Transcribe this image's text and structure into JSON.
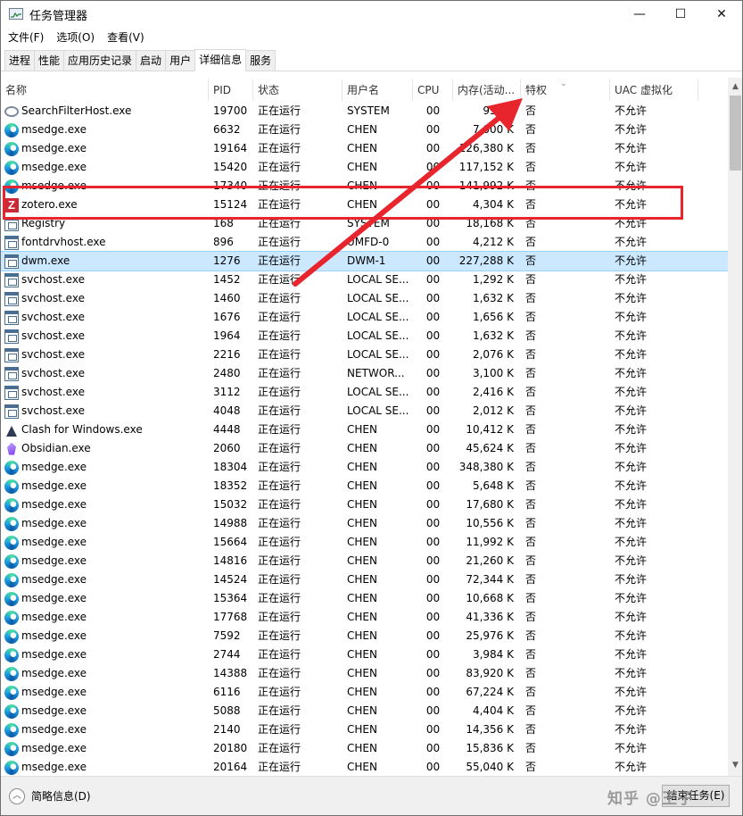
{
  "window": {
    "title": "任务管理器",
    "controls": {
      "minimize": "—",
      "maximize": "☐",
      "close": "✕"
    }
  },
  "menu": [
    "文件(F)",
    "选项(O)",
    "查看(V)"
  ],
  "tabs": [
    {
      "label": "进程",
      "active": false
    },
    {
      "label": "性能",
      "active": false
    },
    {
      "label": "应用历史记录",
      "active": false
    },
    {
      "label": "启动",
      "active": false
    },
    {
      "label": "用户",
      "active": false
    },
    {
      "label": "详细信息",
      "active": true
    },
    {
      "label": "服务",
      "active": false
    }
  ],
  "columns": {
    "name": "名称",
    "pid": "PID",
    "status": "状态",
    "user": "用户名",
    "cpu": "CPU",
    "mem": "内存(活动...",
    "priv": "特权",
    "uac": "UAC 虚拟化"
  },
  "sort_indicator": "⌄",
  "rows": [
    {
      "icon": "search-icon",
      "name": "SearchFilterHost.exe",
      "pid": "19700",
      "status": "正在运行",
      "user": "SYSTEM",
      "cpu": "00",
      "mem": "952 K",
      "priv": "否",
      "uac": "不允许"
    },
    {
      "icon": "edge-icon",
      "name": "msedge.exe",
      "pid": "6632",
      "status": "正在运行",
      "user": "CHEN",
      "cpu": "00",
      "mem": "7,000 K",
      "priv": "否",
      "uac": "不允许"
    },
    {
      "icon": "edge-icon",
      "name": "msedge.exe",
      "pid": "19164",
      "status": "正在运行",
      "user": "CHEN",
      "cpu": "00",
      "mem": "126,380 K",
      "priv": "否",
      "uac": "不允许"
    },
    {
      "icon": "edge-icon",
      "name": "msedge.exe",
      "pid": "15420",
      "status": "正在运行",
      "user": "CHEN",
      "cpu": "00",
      "mem": "117,152 K",
      "priv": "否",
      "uac": "不允许"
    },
    {
      "icon": "edge-icon",
      "name": "msedge.exe",
      "pid": "17340",
      "status": "正在运行",
      "user": "CHEN",
      "cpu": "00",
      "mem": "141,992 K",
      "priv": "否",
      "uac": "不允许"
    },
    {
      "icon": "zotero-icon",
      "name": "zotero.exe",
      "pid": "15124",
      "status": "正在运行",
      "user": "CHEN",
      "cpu": "00",
      "mem": "4,304 K",
      "priv": "否",
      "uac": "不允许"
    },
    {
      "icon": "window-icon",
      "name": "Registry",
      "pid": "168",
      "status": "正在运行",
      "user": "SYSTEM",
      "cpu": "00",
      "mem": "18,168 K",
      "priv": "否",
      "uac": "不允许"
    },
    {
      "icon": "window-icon",
      "name": "fontdrvhost.exe",
      "pid": "896",
      "status": "正在运行",
      "user": "UMFD-0",
      "cpu": "00",
      "mem": "4,212 K",
      "priv": "否",
      "uac": "不允许"
    },
    {
      "icon": "window-icon",
      "name": "dwm.exe",
      "pid": "1276",
      "status": "正在运行",
      "user": "DWM-1",
      "cpu": "00",
      "mem": "227,288 K",
      "priv": "否",
      "uac": "不允许",
      "selected": true
    },
    {
      "icon": "window-icon",
      "name": "svchost.exe",
      "pid": "1452",
      "status": "正在运行",
      "user": "LOCAL SE...",
      "cpu": "00",
      "mem": "1,292 K",
      "priv": "否",
      "uac": "不允许"
    },
    {
      "icon": "window-icon",
      "name": "svchost.exe",
      "pid": "1460",
      "status": "正在运行",
      "user": "LOCAL SE...",
      "cpu": "00",
      "mem": "1,632 K",
      "priv": "否",
      "uac": "不允许"
    },
    {
      "icon": "window-icon",
      "name": "svchost.exe",
      "pid": "1676",
      "status": "正在运行",
      "user": "LOCAL SE...",
      "cpu": "00",
      "mem": "1,656 K",
      "priv": "否",
      "uac": "不允许"
    },
    {
      "icon": "window-icon",
      "name": "svchost.exe",
      "pid": "1964",
      "status": "正在运行",
      "user": "LOCAL SE...",
      "cpu": "00",
      "mem": "1,632 K",
      "priv": "否",
      "uac": "不允许"
    },
    {
      "icon": "window-icon",
      "name": "svchost.exe",
      "pid": "2216",
      "status": "正在运行",
      "user": "LOCAL SE...",
      "cpu": "00",
      "mem": "2,076 K",
      "priv": "否",
      "uac": "不允许"
    },
    {
      "icon": "window-icon",
      "name": "svchost.exe",
      "pid": "2480",
      "status": "正在运行",
      "user": "NETWOR...",
      "cpu": "00",
      "mem": "3,100 K",
      "priv": "否",
      "uac": "不允许"
    },
    {
      "icon": "window-icon",
      "name": "svchost.exe",
      "pid": "3112",
      "status": "正在运行",
      "user": "LOCAL SE...",
      "cpu": "00",
      "mem": "2,416 K",
      "priv": "否",
      "uac": "不允许"
    },
    {
      "icon": "window-icon",
      "name": "svchost.exe",
      "pid": "4048",
      "status": "正在运行",
      "user": "LOCAL SE...",
      "cpu": "00",
      "mem": "2,012 K",
      "priv": "否",
      "uac": "不允许"
    },
    {
      "icon": "clash-icon",
      "name": "Clash for Windows.exe",
      "pid": "4448",
      "status": "正在运行",
      "user": "CHEN",
      "cpu": "00",
      "mem": "10,412 K",
      "priv": "否",
      "uac": "不允许"
    },
    {
      "icon": "obsidian-icon",
      "name": "Obsidian.exe",
      "pid": "2060",
      "status": "正在运行",
      "user": "CHEN",
      "cpu": "00",
      "mem": "45,624 K",
      "priv": "否",
      "uac": "不允许"
    },
    {
      "icon": "edge-icon",
      "name": "msedge.exe",
      "pid": "18304",
      "status": "正在运行",
      "user": "CHEN",
      "cpu": "00",
      "mem": "348,380 K",
      "priv": "否",
      "uac": "不允许"
    },
    {
      "icon": "edge-icon",
      "name": "msedge.exe",
      "pid": "18352",
      "status": "正在运行",
      "user": "CHEN",
      "cpu": "00",
      "mem": "5,648 K",
      "priv": "否",
      "uac": "不允许"
    },
    {
      "icon": "edge-icon",
      "name": "msedge.exe",
      "pid": "15032",
      "status": "正在运行",
      "user": "CHEN",
      "cpu": "00",
      "mem": "17,680 K",
      "priv": "否",
      "uac": "不允许"
    },
    {
      "icon": "edge-icon",
      "name": "msedge.exe",
      "pid": "14988",
      "status": "正在运行",
      "user": "CHEN",
      "cpu": "00",
      "mem": "10,556 K",
      "priv": "否",
      "uac": "不允许"
    },
    {
      "icon": "edge-icon",
      "name": "msedge.exe",
      "pid": "15664",
      "status": "正在运行",
      "user": "CHEN",
      "cpu": "00",
      "mem": "11,992 K",
      "priv": "否",
      "uac": "不允许"
    },
    {
      "icon": "edge-icon",
      "name": "msedge.exe",
      "pid": "14816",
      "status": "正在运行",
      "user": "CHEN",
      "cpu": "00",
      "mem": "21,260 K",
      "priv": "否",
      "uac": "不允许"
    },
    {
      "icon": "edge-icon",
      "name": "msedge.exe",
      "pid": "14524",
      "status": "正在运行",
      "user": "CHEN",
      "cpu": "00",
      "mem": "72,344 K",
      "priv": "否",
      "uac": "不允许"
    },
    {
      "icon": "edge-icon",
      "name": "msedge.exe",
      "pid": "15364",
      "status": "正在运行",
      "user": "CHEN",
      "cpu": "00",
      "mem": "10,668 K",
      "priv": "否",
      "uac": "不允许"
    },
    {
      "icon": "edge-icon",
      "name": "msedge.exe",
      "pid": "17768",
      "status": "正在运行",
      "user": "CHEN",
      "cpu": "00",
      "mem": "41,336 K",
      "priv": "否",
      "uac": "不允许"
    },
    {
      "icon": "edge-icon",
      "name": "msedge.exe",
      "pid": "7592",
      "status": "正在运行",
      "user": "CHEN",
      "cpu": "00",
      "mem": "25,976 K",
      "priv": "否",
      "uac": "不允许"
    },
    {
      "icon": "edge-icon",
      "name": "msedge.exe",
      "pid": "2744",
      "status": "正在运行",
      "user": "CHEN",
      "cpu": "00",
      "mem": "3,984 K",
      "priv": "否",
      "uac": "不允许"
    },
    {
      "icon": "edge-icon",
      "name": "msedge.exe",
      "pid": "14388",
      "status": "正在运行",
      "user": "CHEN",
      "cpu": "00",
      "mem": "83,920 K",
      "priv": "否",
      "uac": "不允许"
    },
    {
      "icon": "edge-icon",
      "name": "msedge.exe",
      "pid": "6116",
      "status": "正在运行",
      "user": "CHEN",
      "cpu": "00",
      "mem": "67,224 K",
      "priv": "否",
      "uac": "不允许"
    },
    {
      "icon": "edge-icon",
      "name": "msedge.exe",
      "pid": "5088",
      "status": "正在运行",
      "user": "CHEN",
      "cpu": "00",
      "mem": "4,404 K",
      "priv": "否",
      "uac": "不允许"
    },
    {
      "icon": "edge-icon",
      "name": "msedge.exe",
      "pid": "2140",
      "status": "正在运行",
      "user": "CHEN",
      "cpu": "00",
      "mem": "14,356 K",
      "priv": "否",
      "uac": "不允许"
    },
    {
      "icon": "edge-icon",
      "name": "msedge.exe",
      "pid": "20180",
      "status": "正在运行",
      "user": "CHEN",
      "cpu": "00",
      "mem": "15,836 K",
      "priv": "否",
      "uac": "不允许"
    },
    {
      "icon": "edge-icon",
      "name": "msedge.exe",
      "pid": "20164",
      "status": "正在运行",
      "user": "CHEN",
      "cpu": "00",
      "mem": "55,040 K",
      "priv": "否",
      "uac": "不允许"
    }
  ],
  "footer": {
    "collapse_label": "简略信息(D)",
    "collapse_glyph": "︿",
    "end_task_label": "结束任务(E)",
    "watermark": "知乎 @王子"
  },
  "annotation": {
    "color": "#e8252d"
  },
  "scrollbar": {
    "up": "▲",
    "down": "▼"
  }
}
